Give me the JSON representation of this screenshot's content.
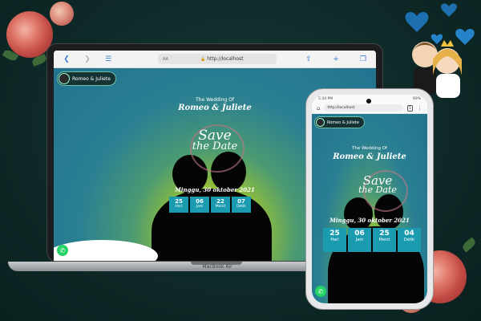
{
  "laptop": {
    "brand_label": "MacBook Air",
    "browser": {
      "text_size_label": "AA",
      "url": "http://localhost"
    }
  },
  "phone": {
    "status_time": "5:34 PM",
    "status_right": "69%",
    "url": "http://localhost"
  },
  "invitation": {
    "couple_chip": "Romeo & Juliete",
    "wedding_of": "The Wedding Of",
    "names": "Romeo & Juliete",
    "save_line1": "Save",
    "save_line2": "the Date",
    "date": "Minggu, 30 oktober 2021"
  },
  "laptop_countdown": [
    {
      "value": "25",
      "label": "Hari"
    },
    {
      "value": "06",
      "label": "Jam"
    },
    {
      "value": "22",
      "label": "Menit"
    },
    {
      "value": "07",
      "label": "Detik"
    }
  ],
  "phone_countdown": [
    {
      "value": "25",
      "label": "Hari"
    },
    {
      "value": "06",
      "label": "Jam"
    },
    {
      "value": "25",
      "label": "Menit"
    },
    {
      "value": "04",
      "label": "Detik"
    }
  ],
  "colors": {
    "teal": "#22738f",
    "lime": "#d7e22a",
    "countdown_box": "#1b9bb0",
    "whatsapp": "#25d366"
  },
  "icons": {
    "back": "chevron-left-icon",
    "forward": "chevron-right-icon",
    "reader": "book-icon",
    "lock": "lock-icon",
    "share": "share-icon",
    "new_tab": "plus-icon",
    "tabs": "tabs-icon",
    "whatsapp": "whatsapp-icon"
  }
}
